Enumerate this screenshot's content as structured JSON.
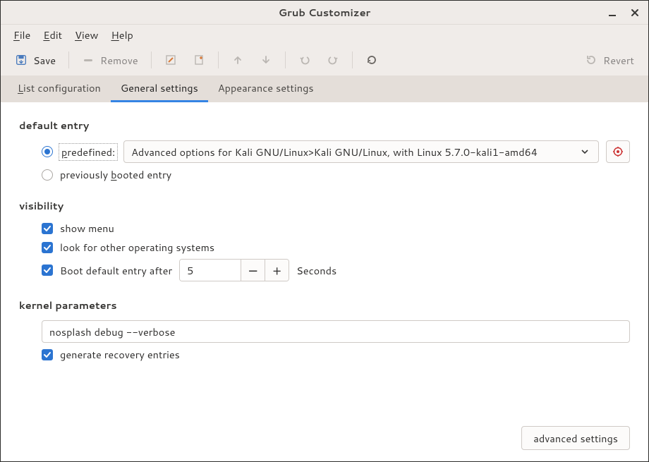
{
  "window": {
    "title": "Grub Customizer"
  },
  "menus": {
    "file": "File",
    "file_m": "F",
    "edit": "Edit",
    "edit_m": "E",
    "view": "View",
    "view_m": "V",
    "help": "Help",
    "help_m": "H"
  },
  "toolbar": {
    "save": "Save",
    "remove": "Remove",
    "revert": "Revert"
  },
  "tabs": {
    "list_label": "List configuration",
    "list_m": "L",
    "general_label": "General settings",
    "appearance_label": "Appearance settings"
  },
  "default_entry": {
    "section_label": "default entry",
    "predefined_label": "predefined:",
    "predefined_m": "p",
    "combo_value": "Advanced options for Kali GNU/Linux>Kali GNU/Linux, with Linux 5.7.0-kali1-amd64",
    "previous_label": "previously booted entry",
    "previous_m": "b"
  },
  "visibility": {
    "section_label": "visibility",
    "show_menu": "show menu",
    "look_os": "look for other operating systems",
    "boot_after": "Boot default entry after",
    "timeout_value": "5",
    "seconds": "Seconds"
  },
  "kernel": {
    "section_label": "kernel parameters",
    "value": "nosplash debug --verbose",
    "recovery": "generate recovery entries"
  },
  "footer": {
    "advanced": "advanced settings"
  }
}
